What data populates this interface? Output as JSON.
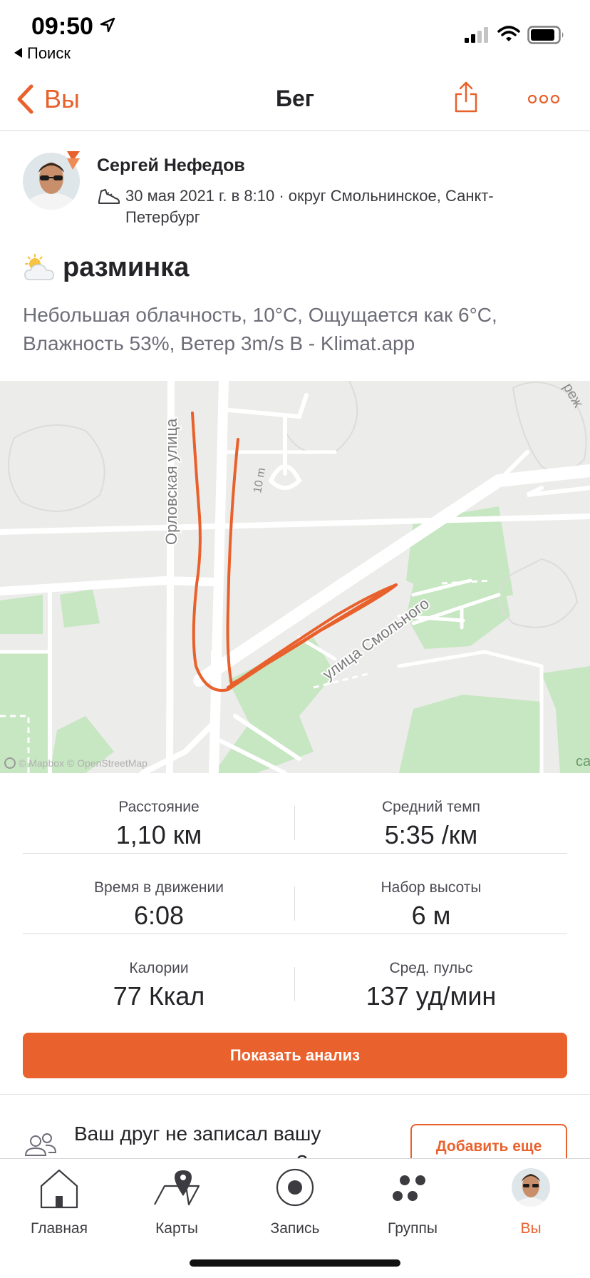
{
  "status_bar": {
    "time": "09:50",
    "back_app_label": "Поиск"
  },
  "nav": {
    "back_label": "Вы",
    "title": "Бег"
  },
  "athlete": {
    "name": "Сергей Нефедов",
    "meta": "30 мая 2021 г. в 8:10 · округ Смольнинское, Санкт-Петербург"
  },
  "activity": {
    "weather_icon": "partly-cloudy-icon",
    "title": "разминка",
    "description": "Небольшая облачность, 10°C, Ощущается как 6°C, Влажность 53%, Ветер 3m/s  В - Klimat.app"
  },
  "map": {
    "street_orlovskaya": "Орловская улица",
    "street_smolnogo": "улица Смольного",
    "contour_label": "10 m",
    "attribution": "© Mapbox © OpenStreetMap",
    "edge_label_top": "реж",
    "edge_label_right": "са",
    "route_color": "#e8612c"
  },
  "stats": [
    {
      "left": {
        "label": "Расстояние",
        "value": "1,10 км"
      },
      "right": {
        "label": "Средний темп",
        "value": "5:35 /км"
      }
    },
    {
      "left": {
        "label": "Время в движении",
        "value": "6:08"
      },
      "right": {
        "label": "Набор высоты",
        "value": "6 м"
      }
    },
    {
      "left": {
        "label": "Калории",
        "value": "77 Ккал"
      },
      "right": {
        "label": "Сред. пульс",
        "value": "137 уд/мин"
      }
    }
  ],
  "analysis_button": "Показать анализ",
  "friends": {
    "text": "Ваш друг не записал вашу совместную тренировку?",
    "add_button": "Добавить еще"
  },
  "tabs": [
    {
      "label": "Главная",
      "icon": "home-icon"
    },
    {
      "label": "Карты",
      "icon": "map-pin-icon"
    },
    {
      "label": "Запись",
      "icon": "record-icon"
    },
    {
      "label": "Группы",
      "icon": "groups-icon"
    },
    {
      "label": "Вы",
      "icon": "profile-avatar",
      "active": true
    }
  ],
  "colors": {
    "accent": "#e9612c",
    "map_park": "#c7e6c2"
  }
}
